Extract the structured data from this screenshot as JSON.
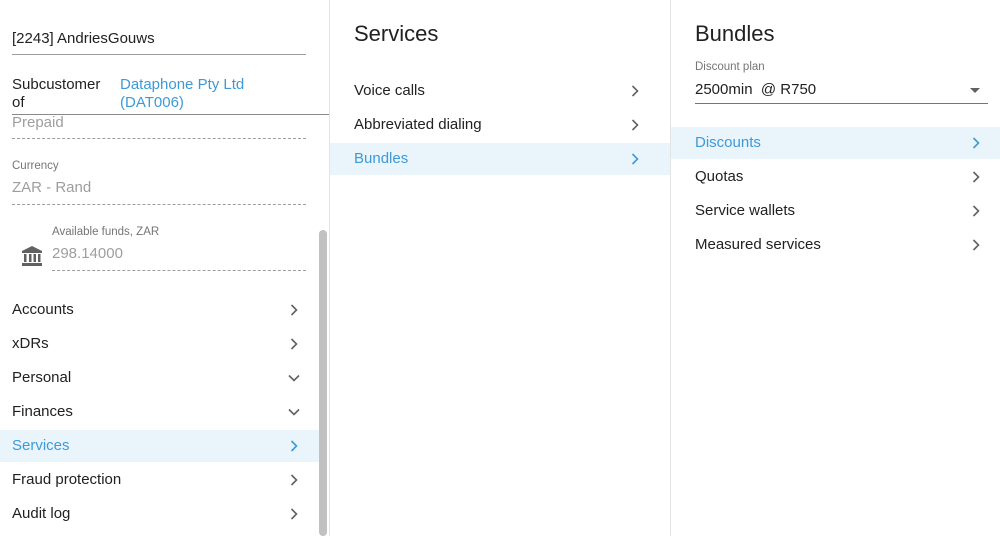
{
  "left": {
    "account_name": "[2243] AndriesGouws",
    "subcustomer_label": "Subcustomer of",
    "subcustomer_link": "Dataphone Pty Ltd (DAT006)",
    "payment_type_value": "Prepaid",
    "currency_caption": "Currency",
    "currency_value": "ZAR - Rand",
    "funds_caption": "Available funds, ZAR",
    "funds_value": "298.14000",
    "menu": [
      {
        "label": "Accounts",
        "chevron": "chevron-right"
      },
      {
        "label": "xDRs",
        "chevron": "chevron-right"
      },
      {
        "label": "Personal",
        "chevron": "chevron-down"
      },
      {
        "label": "Finances",
        "chevron": "chevron-down"
      },
      {
        "label": "Services",
        "chevron": "chevron-right",
        "active": true
      },
      {
        "label": "Fraud protection",
        "chevron": "chevron-right"
      },
      {
        "label": "Audit log",
        "chevron": "chevron-right"
      }
    ]
  },
  "middle": {
    "title": "Services",
    "items": [
      {
        "label": "Voice calls"
      },
      {
        "label": "Abbreviated dialing"
      },
      {
        "label": "Bundles",
        "active": true
      }
    ]
  },
  "right": {
    "title": "Bundles",
    "discount_plan_caption": "Discount plan",
    "discount_plan_value": "2500min  @ R750",
    "items": [
      {
        "label": "Discounts",
        "active": true
      },
      {
        "label": "Quotas"
      },
      {
        "label": "Service wallets"
      },
      {
        "label": "Measured services"
      }
    ]
  },
  "colors": {
    "accent": "#3d9ad6",
    "active_row_bg": "#eaf4fb",
    "text": "#212121",
    "muted": "#9e9e9e"
  }
}
